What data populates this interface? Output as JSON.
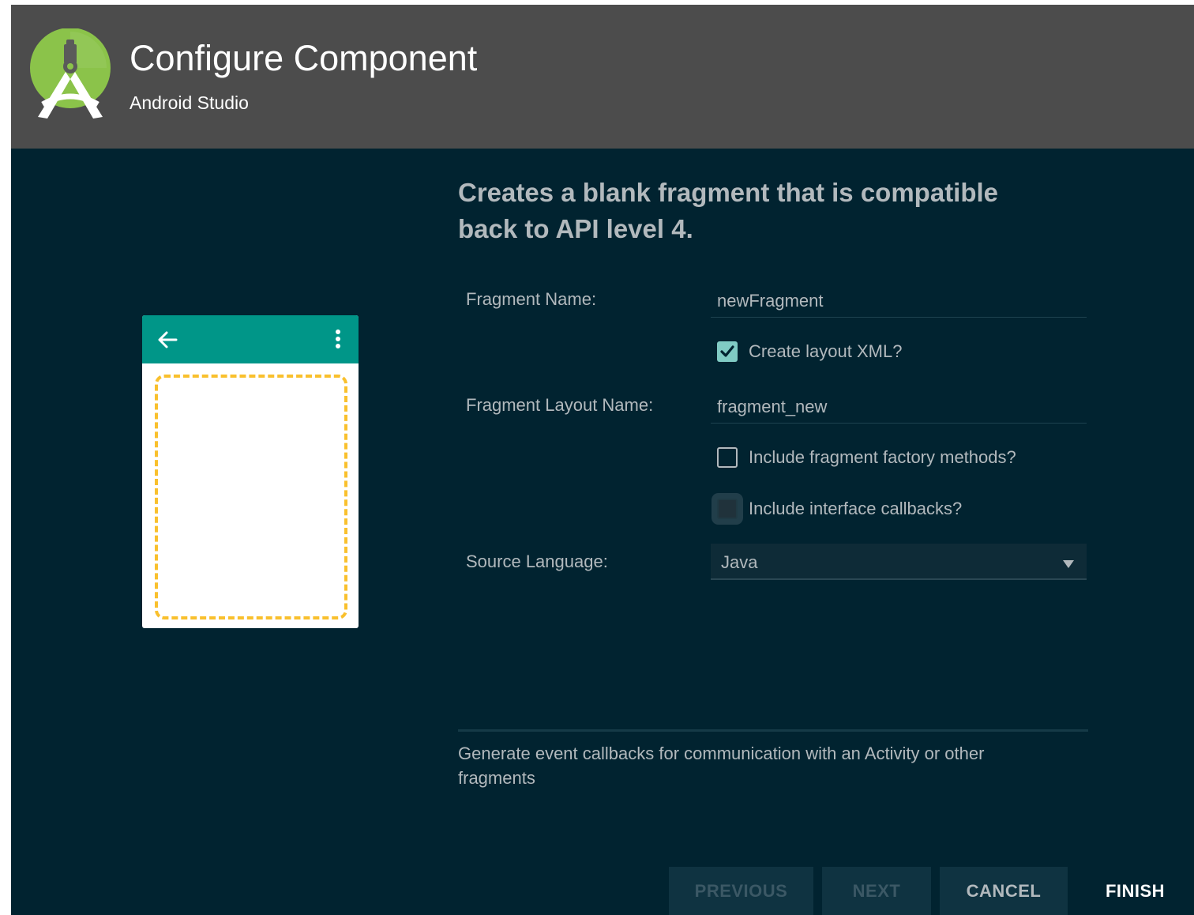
{
  "header": {
    "title": "Configure Component",
    "subtitle": "Android Studio",
    "logo_icon": "android-studio-logo-icon"
  },
  "preview": {
    "back_icon": "arrow-back-icon",
    "overflow_icon": "more-vert-icon",
    "appbar_color": "#009688",
    "fragment_outline_color": "#f9c02d"
  },
  "description": "Creates a blank fragment that is compatible back to API level 4.",
  "form": {
    "fragment_name": {
      "label": "Fragment Name:",
      "value": "newFragment"
    },
    "create_layout_xml": {
      "label": "Create layout XML?",
      "checked": true
    },
    "fragment_layout_name": {
      "label": "Fragment Layout Name:",
      "value": "fragment_new"
    },
    "include_factory_methods": {
      "label": "Include fragment factory methods?",
      "checked": false
    },
    "include_interface_callbacks": {
      "label": "Include interface callbacks?",
      "checked": false
    },
    "source_language": {
      "label": "Source Language:",
      "selected": "Java"
    }
  },
  "help_text": "Generate event callbacks for communication with an Activity or other fragments",
  "buttons": {
    "previous": "PREVIOUS",
    "next": "NEXT",
    "cancel": "CANCEL",
    "finish": "FINISH"
  },
  "colors": {
    "background": "#012330",
    "header": "#4c4c4c",
    "accent": "#80cbc4",
    "text": "#b2b9bd"
  }
}
